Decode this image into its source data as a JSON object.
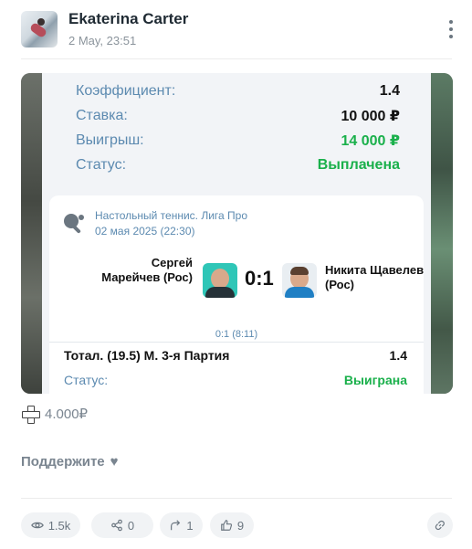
{
  "post": {
    "author": "Ekaterina Carter",
    "date": "2 May, 23:51"
  },
  "bet_slip": {
    "rows": [
      {
        "label": "Коэффициент:",
        "value": "1.4",
        "color": "#111111"
      },
      {
        "label": "Ставка:",
        "value": "10 000 ₽",
        "color": "#111111"
      },
      {
        "label": "Выигрыш:",
        "value": "14 000 ₽",
        "color": "#1ab04b"
      },
      {
        "label": "Статус:",
        "value": "Выплачена",
        "color": "#1ab04b"
      }
    ],
    "match": {
      "league": "Настольный теннис. Лига Про",
      "datetime": "02 мая 2025 (22:30)",
      "player1": "Сергей Марейчев (Рос)",
      "player2": "Никита Щавелев (Рос)",
      "score": "0:1",
      "set_score": "0:1 (8:11)",
      "bet_market": "Тотал. (19.5) М. 3-я Партия",
      "bet_odds": "1.4",
      "bet_status_label": "Статус:",
      "bet_status_value": "Выиграна"
    }
  },
  "donate": {
    "amount": "4.000₽",
    "icon": "plus-icon"
  },
  "support": {
    "label": "Поддержите",
    "icon": "heart-icon"
  },
  "stats": {
    "views": "1.5k",
    "shares": "0",
    "reposts": "1",
    "likes": "9"
  },
  "colors": {
    "accent_green": "#1ab04b",
    "label_blue": "#5c8ab0",
    "muted": "#7a8590"
  }
}
